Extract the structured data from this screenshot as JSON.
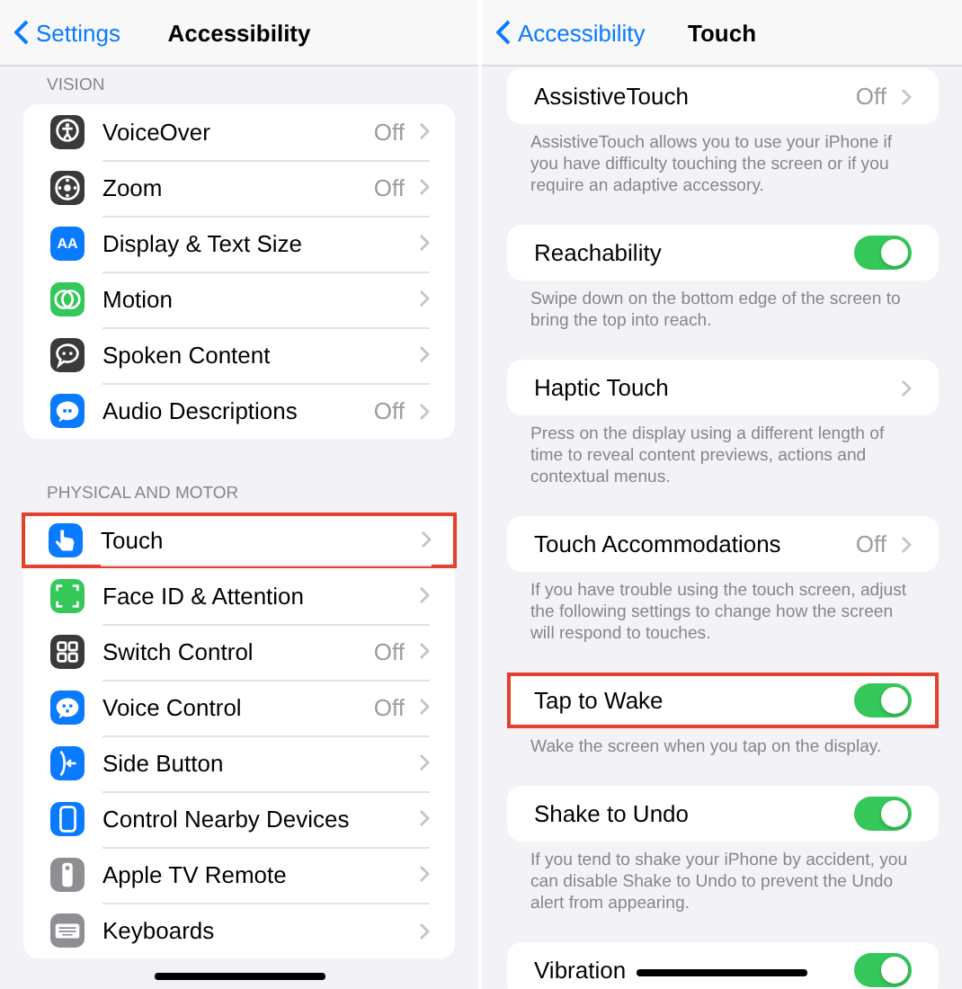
{
  "screens": [
    {
      "nav": {
        "back": "Settings",
        "title": "Accessibility"
      },
      "sections": [
        {
          "header": "VISION",
          "rows": [
            {
              "label": "VoiceOver",
              "value": "Off",
              "highlighted": false
            },
            {
              "label": "Zoom",
              "value": "Off",
              "highlighted": false
            },
            {
              "label": "Display & Text Size",
              "icon_text": "AA",
              "highlighted": false
            },
            {
              "label": "Motion",
              "highlighted": false
            },
            {
              "label": "Spoken Content",
              "highlighted": false
            },
            {
              "label": "Audio Descriptions",
              "value": "Off",
              "highlighted": false
            }
          ]
        },
        {
          "header": "PHYSICAL AND MOTOR",
          "rows": [
            {
              "label": "Touch",
              "highlighted": true
            },
            {
              "label": "Face ID & Attention",
              "highlighted": false
            },
            {
              "label": "Switch Control",
              "value": "Off",
              "highlighted": false
            },
            {
              "label": "Voice Control",
              "value": "Off",
              "highlighted": false
            },
            {
              "label": "Side Button",
              "highlighted": false
            },
            {
              "label": "Control Nearby Devices",
              "highlighted": false
            },
            {
              "label": "Apple TV Remote",
              "highlighted": false
            },
            {
              "label": "Keyboards",
              "highlighted": false
            }
          ]
        }
      ]
    },
    {
      "nav": {
        "back": "Accessibility",
        "title": "Touch"
      },
      "groups": [
        {
          "kind": "link",
          "label": "AssistiveTouch",
          "value": "Off",
          "highlighted": false,
          "footer": "AssistiveTouch allows you to use your iPhone if you have difficulty touching the screen or if you require an adaptive accessory."
        },
        {
          "kind": "toggle",
          "label": "Reachability",
          "on": true,
          "highlighted": false,
          "footer": "Swipe down on the bottom edge of the screen to bring the top into reach."
        },
        {
          "kind": "link",
          "label": "Haptic Touch",
          "highlighted": false,
          "footer": "Press on the display using a different length of time to reveal content previews, actions and contextual menus."
        },
        {
          "kind": "link",
          "label": "Touch Accommodations",
          "value": "Off",
          "highlighted": false,
          "footer": "If you have trouble using the touch screen, adjust the following settings to change how the screen will respond to touches."
        },
        {
          "kind": "toggle",
          "label": "Tap to Wake",
          "on": true,
          "highlighted": true,
          "footer": "Wake the screen when you tap on the display."
        },
        {
          "kind": "toggle",
          "label": "Shake to Undo",
          "on": true,
          "highlighted": false,
          "footer": "If you tend to shake your iPhone by accident, you can disable Shake to Undo to prevent the Undo alert from appearing."
        },
        {
          "kind": "toggle",
          "label": "Vibration",
          "on": true,
          "highlighted": false
        }
      ]
    }
  ]
}
